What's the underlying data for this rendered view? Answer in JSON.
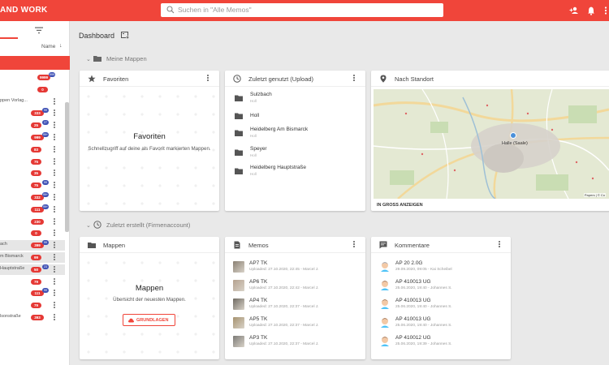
{
  "app": {
    "brand": "AND WORK",
    "search_placeholder": "Suchen in \"Alle Memos\"",
    "accent": "#f0453a"
  },
  "sidebar": {
    "sort_label": "Name",
    "sort_arrow": "↓",
    "rows": [
      {
        "label": "",
        "badge": "9999",
        "bubble": "999"
      },
      {
        "label": "",
        "badge": "0",
        "bubble": ""
      },
      {
        "label": "ppen Vorlag...",
        "badge": "",
        "bubble": ""
      },
      {
        "label": "",
        "badge": "333",
        "bubble": "99"
      },
      {
        "label": "",
        "badge": "25",
        "bubble": "27"
      },
      {
        "label": "",
        "badge": "999",
        "bubble": "99+"
      },
      {
        "label": "",
        "badge": "83",
        "bubble": ""
      },
      {
        "label": "",
        "badge": "75",
        "bubble": ""
      },
      {
        "label": "",
        "badge": "35",
        "bubble": ""
      },
      {
        "label": "",
        "badge": "75",
        "bubble": "99"
      },
      {
        "label": "",
        "badge": "332",
        "bubble": "99+"
      },
      {
        "label": "",
        "badge": "111",
        "bubble": "99+"
      },
      {
        "label": "",
        "badge": "230",
        "bubble": ""
      },
      {
        "label": "",
        "badge": "0",
        "bubble": ""
      },
      {
        "label": "ach",
        "badge": "399",
        "bubble": "99"
      },
      {
        "label": "m Bismarck",
        "badge": "99",
        "bubble": ""
      },
      {
        "label": "Hauptstraße",
        "badge": "50",
        "bubble": "23"
      },
      {
        "label": "",
        "badge": "79",
        "bubble": ""
      },
      {
        "label": "",
        "badge": "111",
        "bubble": "99"
      },
      {
        "label": "",
        "badge": "79",
        "bubble": ""
      },
      {
        "label": "lsonstraße",
        "badge": "393",
        "bubble": ""
      }
    ]
  },
  "main": {
    "title": "Dashboard",
    "section_1": "Meine Mappen",
    "section_2": "Zuletzt erstellt (Firmenaccount)",
    "favoriten": {
      "title": "Favoriten",
      "empty_title": "Favoriten",
      "empty_sub": "Schnellzugriff auf deine als Favorit markierten Mappen."
    },
    "recent": {
      "title": "Zuletzt genutzt (Upload)",
      "items": [
        {
          "name": "Sulzbach",
          "sub": "Holl"
        },
        {
          "name": "Holl",
          "sub": ""
        },
        {
          "name": "Heidelberg Am Bismarck",
          "sub": "Holl"
        },
        {
          "name": "Speyer",
          "sub": "Holl"
        },
        {
          "name": "Heidelberg Hauptstraße",
          "sub": "Holl"
        }
      ]
    },
    "location": {
      "title": "Nach Standort",
      "link": "IN GROSS ANZEIGEN",
      "map_label": "Halle (Saale)",
      "attribution": "Papers | © Co"
    },
    "mappen": {
      "title": "Mappen",
      "empty_title": "Mappen",
      "empty_sub": "Übersicht der neuesten Mappen.",
      "button": "GRUNDLAGEN"
    },
    "memos": {
      "title": "Memos",
      "items": [
        {
          "name": "AP7 TK",
          "meta": "Uploaded: 27.10.2020, 22:45 - Marcel J."
        },
        {
          "name": "AP6 TK",
          "meta": "Uploaded: 27.10.2020, 22:42 - Marcel J."
        },
        {
          "name": "AP4 TK",
          "meta": "Uploaded: 27.10.2020, 22:37 - Marcel J."
        },
        {
          "name": "AP5 TK",
          "meta": "Uploaded: 27.10.2020, 22:37 - Marcel J."
        },
        {
          "name": "AP3 TK",
          "meta": "Uploaded: 27.10.2020, 22:37 - Marcel J."
        }
      ]
    },
    "kommentare": {
      "title": "Kommentare",
      "items": [
        {
          "name": "AP 20 2.0G",
          "meta": "29.09.2020, 09:05 - Kai Scheibel"
        },
        {
          "name": "AP 410013 UG",
          "meta": "25.06.2020, 19:40 - Johannes S."
        },
        {
          "name": "AP 410013 UG",
          "meta": "25.06.2020, 19:40 - Johannes S."
        },
        {
          "name": "AP 410013 UG",
          "meta": "25.06.2020, 19:40 - Johannes S."
        },
        {
          "name": "AP 410012 UG",
          "meta": "25.06.2020, 19:39 - Johannes S."
        }
      ]
    }
  }
}
